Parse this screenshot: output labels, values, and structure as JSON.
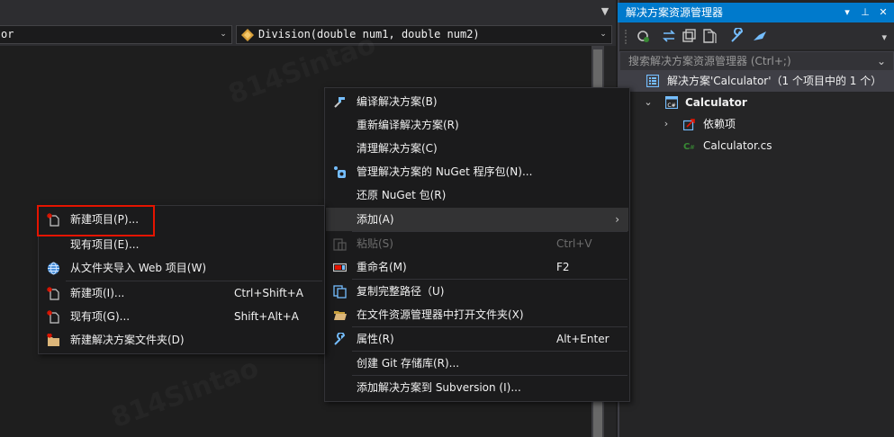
{
  "editor": {
    "left_combo_value": "or",
    "right_combo_value": "Division(double num1, double num2)"
  },
  "solution_explorer": {
    "title": "解决方案资源管理器",
    "pin_glyph": "▾",
    "pushpin_glyph": "⊥",
    "close_glyph": "✕",
    "search_placeholder": "搜索解决方案资源管理器 (Ctrl+;)",
    "tree": {
      "solution_label": "解决方案'Calculator'（1 个项目中的 1 个）",
      "project_label": "Calculator",
      "dependencies_label": "依赖项",
      "file_label": "Calculator.cs"
    },
    "icons": [
      "sync-icon",
      "switch-views-icon",
      "collapse-all-icon",
      "show-all-files-icon",
      "properties-icon",
      "preview-icon"
    ]
  },
  "context_menu": {
    "items": [
      {
        "label": "编译解决方案(B)",
        "shortcut": "",
        "icon": "build-icon"
      },
      {
        "label": "重新编译解决方案(R)",
        "shortcut": "",
        "icon": ""
      },
      {
        "label": "清理解决方案(C)",
        "shortcut": "",
        "icon": ""
      },
      {
        "label": "管理解决方案的 NuGet 程序包(N)...",
        "shortcut": "",
        "icon": "nuget-icon"
      },
      {
        "label": "还原 NuGet 包(R)",
        "shortcut": "",
        "icon": ""
      },
      {
        "label": "添加(A)",
        "shortcut": "",
        "icon": "",
        "submenu_arrow": "›"
      },
      {
        "label": "粘贴(S)",
        "shortcut": "Ctrl+V",
        "icon": "paste-icon"
      },
      {
        "label": "重命名(M)",
        "shortcut": "F2",
        "icon": "rename-icon"
      },
      {
        "label": "复制完整路径（U)",
        "shortcut": "",
        "icon": "copy-path-icon"
      },
      {
        "label": "在文件资源管理器中打开文件夹(X)",
        "shortcut": "",
        "icon": "folder-open-icon"
      },
      {
        "label": "属性(R)",
        "shortcut": "Alt+Enter",
        "icon": "properties-icon"
      },
      {
        "label": "创建 Git 存储库(R)...",
        "shortcut": "",
        "icon": ""
      },
      {
        "label": "添加解决方案到 Subversion (I)...",
        "shortcut": "",
        "icon": ""
      }
    ]
  },
  "submenu": {
    "items": [
      {
        "label": "新建项目(P)...",
        "shortcut": "",
        "icon": "new-project-icon"
      },
      {
        "label": "现有项目(E)...",
        "shortcut": "",
        "icon": ""
      },
      {
        "label": "从文件夹导入 Web 项目(W)",
        "shortcut": "",
        "icon": "globe-icon"
      },
      {
        "label": "新建项(I)...",
        "shortcut": "Ctrl+Shift+A",
        "icon": "new-item-icon"
      },
      {
        "label": "现有项(G)...",
        "shortcut": "Shift+Alt+A",
        "icon": "existing-item-icon"
      },
      {
        "label": "新建解决方案文件夹(D)",
        "shortcut": "",
        "icon": "new-folder-icon"
      }
    ]
  },
  "colors": {
    "accent": "#007acc",
    "highlight_border": "#e51400",
    "menu_bg": "#1b1b1c"
  }
}
